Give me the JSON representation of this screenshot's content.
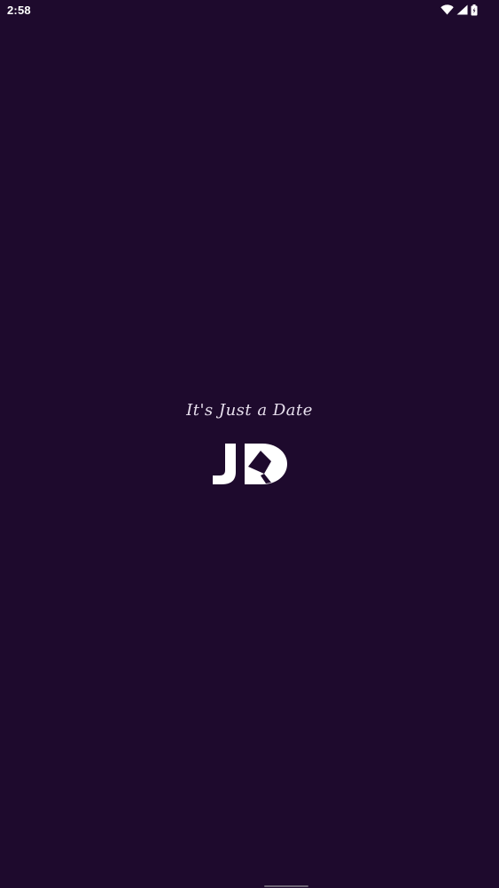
{
  "status_bar": {
    "time": "2:58",
    "icons": [
      "wifi-icon",
      "signal-icon",
      "battery-icon"
    ]
  },
  "splash": {
    "tagline": "It's Just a Date",
    "logo_text": "JD"
  },
  "colors": {
    "background": "#1e0a2d",
    "foreground": "#ffffff"
  }
}
